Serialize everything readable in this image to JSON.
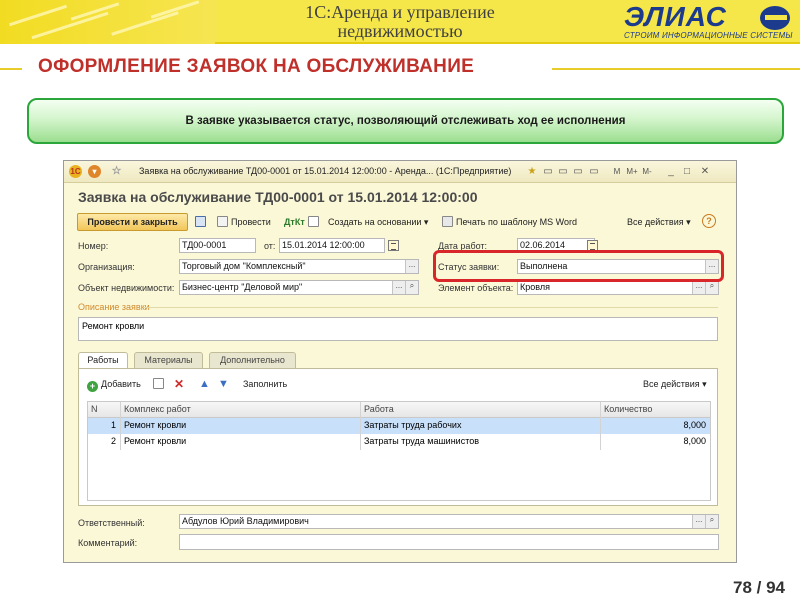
{
  "banner": {
    "title_line1": "1С:Аренда и управление",
    "title_line2": "недвижимостью"
  },
  "logo": {
    "name": "ЭЛИАС",
    "tagline": "СТРОИМ ИНФОРМАЦИОННЫЕ СИСТЕМЫ",
    "color": "#1d3b8c"
  },
  "slide": {
    "heading": "ОФОРМЛЕНИЕ ЗАЯВОК НА ОБСЛУЖИВАНИЕ",
    "note": "В заявке указывается статус, позволяющий отслеживать ход ее исполнения",
    "page": "78 / 94",
    "accent_color": "#c0302a",
    "highlight_color": "#d9262a"
  },
  "window": {
    "titlebar": "Заявка на обслуживание ТД00-0001 от 15.01.2014 12:00:00 - Аренда...   (1С:Предприятие)",
    "doc_title": "Заявка на обслуживание ТД00-0001 от 15.01.2014 12:00:00",
    "toolbar": {
      "post_close": "Провести и закрыть",
      "post": "Провести",
      "create_based": "Создать на основании",
      "print_template": "Печать по шаблону MS Word",
      "all_actions": "Все действия",
      "help": "?"
    },
    "form": {
      "number_label": "Номер:",
      "number_value": "ТД00-0001",
      "from_label": "от:",
      "from_value": "15.01.2014 12:00:00",
      "work_date_label": "Дата работ:",
      "work_date_value": "02.06.2014",
      "org_label": "Организация:",
      "org_value": "Торговый дом \"Комплексный\"",
      "status_label": "Статус заявки:",
      "status_value": "Выполнена",
      "property_label": "Объект недвижимости:",
      "property_value": "Бизнес-центр \"Деловой мир\"",
      "element_label": "Элемент объекта:",
      "element_value": "Кровля",
      "desc_label": "Описание заявки",
      "desc_value": "Ремонт кровли",
      "responsible_label": "Ответственный:",
      "responsible_value": "Абдулов Юрий Владимирович",
      "comment_label": "Комментарий:",
      "comment_value": ""
    },
    "tabs": [
      "Работы",
      "Материалы",
      "Дополнительно"
    ],
    "tab_toolbar": {
      "add": "Добавить",
      "fill": "Заполнить",
      "all_actions": "Все действия"
    },
    "table": {
      "headers": [
        "N",
        "Комплекс работ",
        "Работа",
        "Количество"
      ],
      "rows": [
        [
          "1",
          "Ремонт кровли",
          "Затраты труда рабочих",
          "8,000"
        ],
        [
          "2",
          "Ремонт кровли",
          "Затраты труда машинистов",
          "8,000"
        ]
      ]
    }
  }
}
